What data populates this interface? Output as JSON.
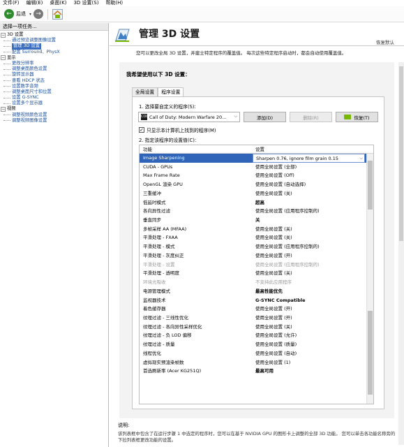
{
  "menubar": {
    "items": [
      "文件(F)",
      "编辑(E)",
      "桌面(K)",
      "3D 设置(S)",
      "帮助(H)"
    ]
  },
  "toolbar": {
    "back_label": "后退",
    "icons": [
      "back-arrow-icon",
      "forward-arrow-icon",
      "home-icon"
    ]
  },
  "sidebar": {
    "title": "选择一项任务...",
    "tree": [
      {
        "label": "3D 设置",
        "type": "group"
      },
      {
        "label": "通过预览调整图像设置",
        "type": "child"
      },
      {
        "label": "管理 3D 设置",
        "type": "child",
        "selected": true
      },
      {
        "label": "配置 Surround、PhysX",
        "type": "child"
      },
      {
        "label": "显示",
        "type": "group"
      },
      {
        "label": "更改分辨率",
        "type": "child"
      },
      {
        "label": "调整桌面颜色设置",
        "type": "child"
      },
      {
        "label": "旋转显示器",
        "type": "child"
      },
      {
        "label": "查看 HDCP 状态",
        "type": "child"
      },
      {
        "label": "设置数字音频",
        "type": "child"
      },
      {
        "label": "调整桌面尺寸和位置",
        "type": "child"
      },
      {
        "label": "设置 G-SYNC",
        "type": "child"
      },
      {
        "label": "设置多个显示器",
        "type": "child"
      },
      {
        "label": "视频",
        "type": "group"
      },
      {
        "label": "调整视频颜色设置",
        "type": "child"
      },
      {
        "label": "调整视频图像设置",
        "type": "child"
      }
    ]
  },
  "header": {
    "title": "管理 3D 设置",
    "restore_defaults": "恢复默认",
    "description": "您可以更改全局 3D 设置，并建立特定程序的覆盖值。 每次这些特定程序启动时，都会自动使用覆盖值。"
  },
  "main": {
    "section_title": "我希望使用以下 3D 设置：",
    "tabs": [
      {
        "label": "全局设置",
        "active": false
      },
      {
        "label": "程序设置",
        "active": true
      }
    ],
    "step1_label": "1. 选择要自定义的程序(S):",
    "program_selected": "Call of Duty: Modern Warfare 20...",
    "add_button": "添加(D)",
    "remove_button": "删除(R)",
    "restore_button": "恢复(T)",
    "checkbox_label": "只显示本计算机上找到的程序(M)",
    "checkbox_checked": true,
    "step2_label": "2. 指定该程序的设置值(C):",
    "table": {
      "headers": [
        "功能",
        "设置"
      ],
      "rows": [
        {
          "feature": "Image Sharpening",
          "value": "Sharpen 0.76, ignore film grain 0.15",
          "selected": true
        },
        {
          "feature": "CUDA - GPUs",
          "value": "使用全局设置 (全部)"
        },
        {
          "feature": "Max Frame Rate",
          "value": "使用全局设置 (Off)"
        },
        {
          "feature": "OpenGL 渲染 GPU",
          "value": "使用全局设置 (自动选择)"
        },
        {
          "feature": "三重缓冲",
          "value": "使用全局设置 (关)"
        },
        {
          "feature": "低延时模式",
          "value": "超高",
          "bold": true
        },
        {
          "feature": "各向异性过滤",
          "value": "使用全局设置 (应用程序控制的)"
        },
        {
          "feature": "垂直同步",
          "value": "关",
          "bold": true
        },
        {
          "feature": "多帧采样 AA (MFAA)",
          "value": "使用全局设置 (关)"
        },
        {
          "feature": "平滑处理 - FXAA",
          "value": "使用全局设置 (关)"
        },
        {
          "feature": "平滑处理 - 模式",
          "value": "使用全局设置 (应用程序控制的)"
        },
        {
          "feature": "平滑处理 - 灰度纠正",
          "value": "使用全局设置 (开)"
        },
        {
          "feature": "平滑处理 - 设置",
          "value": "使用全局设置 (应用程序控制的)",
          "dim": true
        },
        {
          "feature": "平滑处理 - 透明度",
          "value": "使用全局设置 (关)"
        },
        {
          "feature": "环境光吸收",
          "value": "不支持此应用程序",
          "dim": true
        },
        {
          "feature": "电源管理模式",
          "value": "最高性能优先",
          "bold": true
        },
        {
          "feature": "监视器技术",
          "value": "G-SYNC Compatible",
          "bold": true
        },
        {
          "feature": "着色缓存器",
          "value": "使用全局设置 (开)"
        },
        {
          "feature": "纹理过滤 - 三线性优化",
          "value": "使用全局设置 (开)"
        },
        {
          "feature": "纹理过滤 - 各向异性采样优化",
          "value": "使用全局设置 (关)"
        },
        {
          "feature": "纹理过滤 - 负 LOD 偏移",
          "value": "使用全局设置 (允许)"
        },
        {
          "feature": "纹理过滤 - 质量",
          "value": "使用全局设置 (质量)"
        },
        {
          "feature": "线程优化",
          "value": "使用全局设置 (自动)"
        },
        {
          "feature": "虚拟现实预渲染帧数",
          "value": "使用全局设置 (1)"
        },
        {
          "feature": "首选刷新率 (Acer KG251Q)",
          "value": "最高可用",
          "bold": true
        }
      ]
    }
  },
  "footer": {
    "label": "说明:",
    "text": "该列表框中包含了在运行步骤 1 中选定的程序时，您可以在基于 NVIDIA GPU 的图形卡上调整的全部 3D 功能。 您可以单击各功能名称旁的下拉列表框更改功能的设置。"
  },
  "colors": {
    "selection": "#2f64b8",
    "nvidia_green": "#76b900",
    "link": "#1a4f9c"
  }
}
